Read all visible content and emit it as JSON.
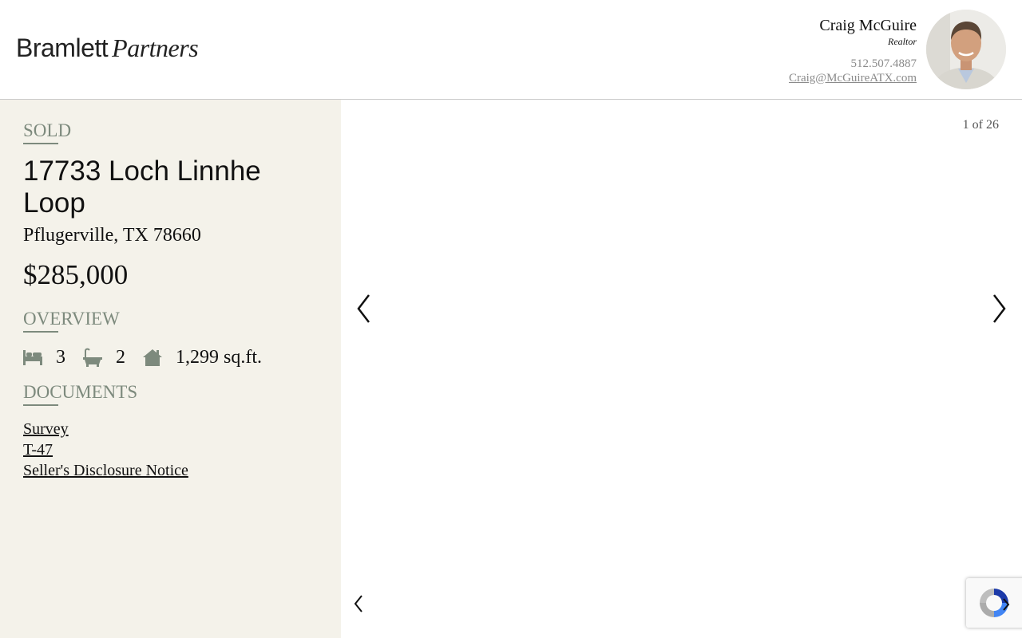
{
  "brand": {
    "logo_part1": "Bramlett",
    "logo_part2": "Partners"
  },
  "agent": {
    "name": "Craig McGuire",
    "title": "Realtor",
    "phone": "512.507.4887",
    "email": "Craig@McGuireATX.com"
  },
  "listing": {
    "status": "SOLD",
    "address": "17733 Loch Linnhe Loop",
    "city_state_zip": "Pflugerville, TX 78660",
    "price": "$285,000"
  },
  "overview": {
    "heading": "OVERVIEW",
    "beds": "3",
    "baths": "2",
    "sqft": "1,299 sq.ft.",
    "icons": [
      "bed-icon",
      "bathtub-icon",
      "house-icon"
    ]
  },
  "documents": {
    "heading": "DOCUMENTS",
    "items": [
      "Survey",
      "T-47",
      "Seller's Disclosure Notice"
    ]
  },
  "gallery": {
    "counter": "1 of 26"
  },
  "colors": {
    "accent": "#7d8a7d",
    "sidebar_bg": "#f4f2ea"
  }
}
